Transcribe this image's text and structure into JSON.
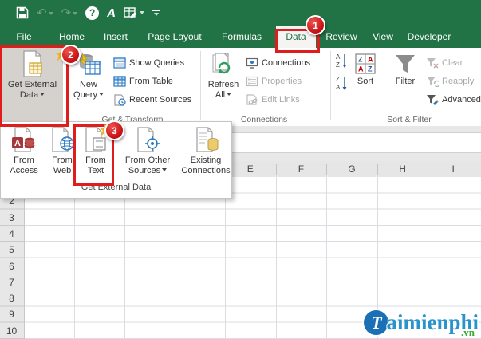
{
  "qat": {
    "undo": "↶",
    "redo": "↷",
    "help": "?",
    "font_tool": "A"
  },
  "icons": {
    "letter_a": "A",
    "letter_z": "Z"
  },
  "tabs": {
    "items": [
      {
        "label": "File"
      },
      {
        "label": "Home"
      },
      {
        "label": "Insert"
      },
      {
        "label": "Page Layout"
      },
      {
        "label": "Formulas"
      },
      {
        "label": "Data",
        "active": true
      },
      {
        "label": "Review"
      },
      {
        "label": "View"
      },
      {
        "label": "Developer"
      }
    ]
  },
  "ribbon": {
    "groups": [
      {
        "label": "Get & Transform",
        "big_buttons": [
          {
            "id": "get-external-data",
            "lines": [
              "Get External",
              "Data"
            ],
            "pressed": true
          },
          {
            "id": "new-query",
            "lines": [
              "New",
              "Query"
            ]
          }
        ],
        "small_buttons": [
          {
            "id": "show-queries",
            "label": "Show Queries"
          },
          {
            "id": "from-table",
            "label": "From Table"
          },
          {
            "id": "recent-sources",
            "label": "Recent Sources"
          }
        ]
      },
      {
        "label": "Connections",
        "big_buttons": [
          {
            "id": "refresh-all",
            "lines": [
              "Refresh",
              "All"
            ]
          }
        ],
        "small_buttons": [
          {
            "id": "connections",
            "label": "Connections"
          },
          {
            "id": "properties",
            "label": "Properties",
            "disabled": true
          },
          {
            "id": "edit-links",
            "label": "Edit Links",
            "disabled": true
          }
        ]
      },
      {
        "label": "Sort & Filter",
        "big_buttons": [
          {
            "id": "sort",
            "lines": [
              "Sort"
            ]
          },
          {
            "id": "filter",
            "lines": [
              "Filter"
            ]
          }
        ],
        "small_buttons": [
          {
            "id": "clear",
            "label": "Clear",
            "disabled": true
          },
          {
            "id": "reapply",
            "label": "Reapply",
            "disabled": true
          },
          {
            "id": "advanced",
            "label": "Advanced"
          }
        ]
      }
    ]
  },
  "dropdown": {
    "items": [
      {
        "line1": "From",
        "line2": "Access"
      },
      {
        "line1": "From",
        "line2": "Web"
      },
      {
        "line1": "From",
        "line2": "Text"
      },
      {
        "line1": "From Other",
        "line2": "Sources",
        "arrow": true
      },
      {
        "line1": "Existing",
        "line2": "Connections"
      }
    ],
    "footer": "Get External Data"
  },
  "annotations": {
    "step1": "1",
    "step2": "2",
    "step3": "3"
  },
  "sheet": {
    "columns": [
      "E",
      "F",
      "G",
      "H",
      "I"
    ],
    "rows": [
      "2",
      "3",
      "4",
      "5",
      "6",
      "7",
      "8",
      "9",
      "10"
    ]
  },
  "watermark": {
    "initial": "T",
    "name": "aimienphi",
    "tld": ".vn"
  },
  "colors": {
    "brand_green": "#217346",
    "annotation_red": "#df1d1d",
    "pressed_gray": "#d5d1cc"
  }
}
